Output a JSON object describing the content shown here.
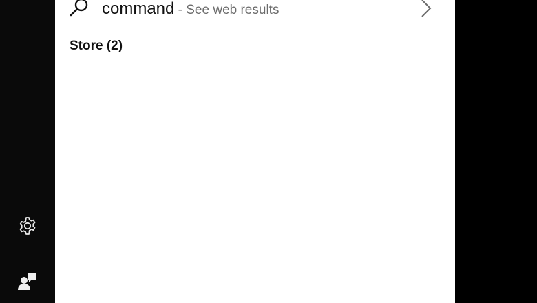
{
  "search": {
    "query": "command",
    "hint": " - See web results",
    "icon": "search-icon"
  },
  "sections": {
    "store_header": "Store (2)"
  },
  "rail": {
    "settings_icon": "gear-icon",
    "feedback_icon": "feedback-icon"
  },
  "colors": {
    "panel_bg": "#ffffff",
    "rail_bg": "#0a0a0a",
    "text": "#111111",
    "hint_text": "#6b6b6b"
  }
}
